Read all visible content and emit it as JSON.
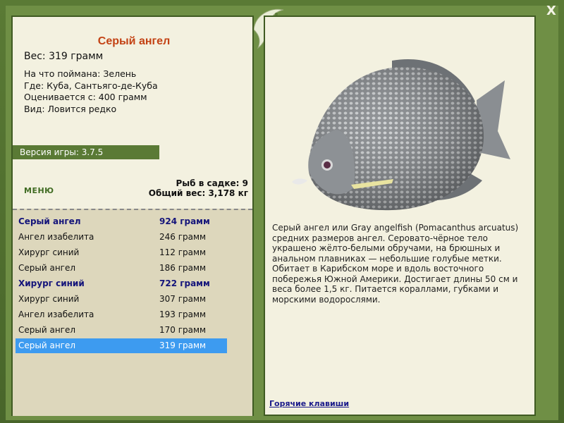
{
  "close_label": "X",
  "fish": {
    "name": "Серый ангел",
    "weight_label": "Вес: 319 грамм",
    "caught_on": "На что поймана: Зелень",
    "location": "Где: Куба, Сантьяго-де-Куба",
    "valued_from": "Оценивается с: 400 грамм",
    "kind": "Вид: Ловится редко"
  },
  "version": "Версия игры: 3.7.5",
  "menu_label": "МЕНЮ",
  "stats": {
    "fish_in_keepnet": "Рыб в садке: 9",
    "total_weight": "Общий вес: 3,178 кг"
  },
  "catch_list": [
    {
      "name": "Серый ангел",
      "weight": "924 грамм",
      "bold": true
    },
    {
      "name": "Ангел изабелита",
      "weight": "246 грамм"
    },
    {
      "name": "Хирург синий",
      "weight": "112 грамм"
    },
    {
      "name": "Серый ангел",
      "weight": "186 грамм"
    },
    {
      "name": "Хирург синий",
      "weight": "722 грамм",
      "bold": true
    },
    {
      "name": "Хирург синий",
      "weight": "307 грамм"
    },
    {
      "name": "Ангел изабелита",
      "weight": "193 грамм"
    },
    {
      "name": "Серый ангел",
      "weight": "170 грамм"
    },
    {
      "name": "Серый ангел",
      "weight": "319 грамм",
      "selected": true
    }
  ],
  "description": "Серый ангел или Gray angelfish (Pomacanthus arcuatus) средних размеров ангел. Серовато-чёрное тело украшено жёлто-белыми обручами, на брюшных и анальном плавниках — небольшие голубые метки. Обитает в Карибском море и вдоль восточного побережья Южной Америки. Достигает длины 50 см и веса более 1,5 кг. Питается кораллами, губками и морскими водорослями.",
  "hotkeys_label": "Горячие клавиши",
  "colors": {
    "frame": "#5a7a35",
    "panel": "#f3f1e0",
    "title": "#c34214",
    "selection": "#3d9bf0",
    "bold_row": "#14147a"
  }
}
